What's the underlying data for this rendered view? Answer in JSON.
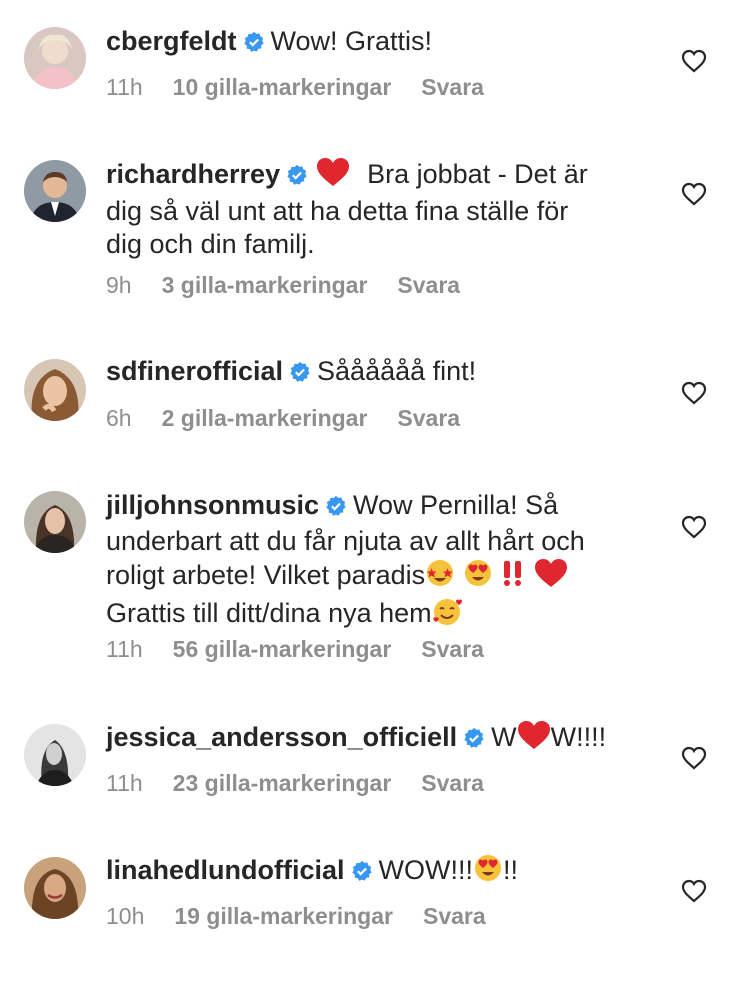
{
  "colors": {
    "text": "#262626",
    "meta": "#8e8e8e",
    "verified": "#3897f0",
    "heart": "#e0262f"
  },
  "icons": {
    "verified": "verified-badge-icon",
    "like": "heart-outline-icon"
  },
  "comments": [
    {
      "username": "cbergfeldt",
      "segments": [
        "Wow! Grattis!"
      ],
      "time": "11h",
      "likes": "10 gilla-markeringar",
      "reply": "Svara"
    },
    {
      "username": "richardherrey",
      "segments": [
        "Bra jobbat - Det är",
        "dig så väl unt att ha detta fina ställe för",
        "dig och din familj."
      ],
      "time": "9h",
      "likes": "3 gilla-markeringar",
      "reply": "Svara"
    },
    {
      "username": "sdfinerofficial",
      "segments": [
        "Såååååå fint!"
      ],
      "time": "6h",
      "likes": "2 gilla-markeringar",
      "reply": "Svara"
    },
    {
      "username": "jilljohnsonmusic",
      "segments": [
        "Wow Pernilla! Så",
        "underbart att du får njuta av allt hårt och",
        "roligt arbete! Vilket paradis",
        "Grattis till ditt/dina nya hem"
      ],
      "time": "11h",
      "likes": "56 gilla-markeringar",
      "reply": "Svara"
    },
    {
      "username": "jessica_andersson_officiell",
      "segments": [
        "W",
        "W!!!!"
      ],
      "time": "11h",
      "likes": "23 gilla-markeringar",
      "reply": "Svara"
    },
    {
      "username": "linahedlundofficial",
      "segments": [
        "WOW!!!",
        "!!"
      ],
      "time": "10h",
      "likes": "19 gilla-markeringar",
      "reply": "Svara"
    }
  ]
}
